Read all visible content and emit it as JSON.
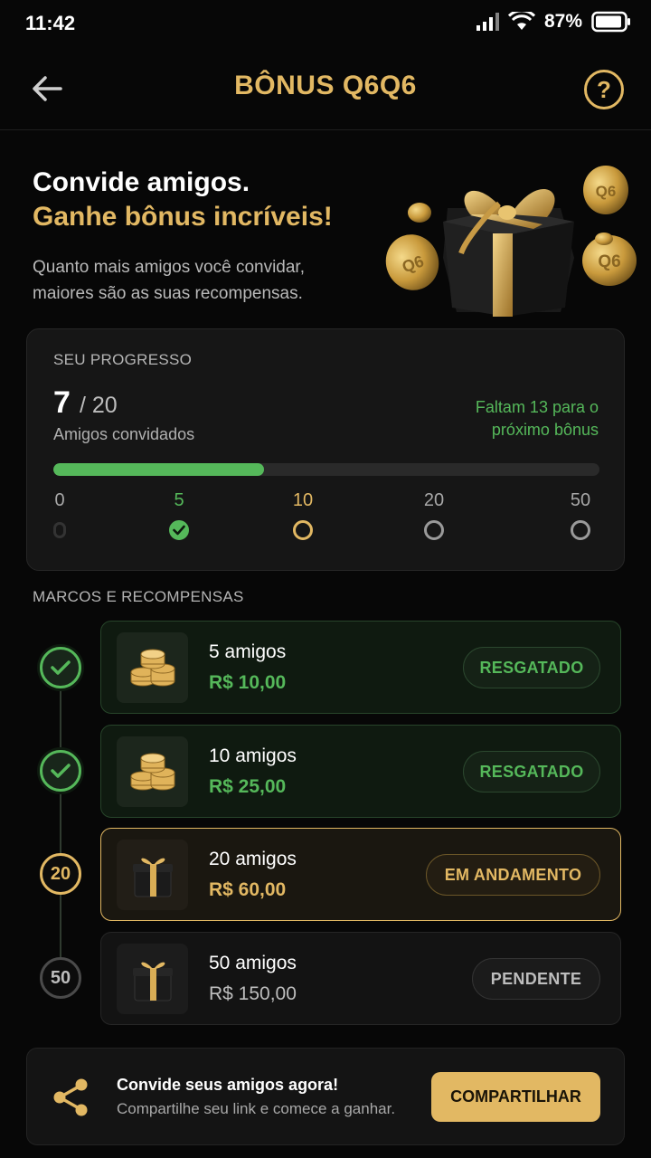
{
  "status_bar": {
    "time": "11:42",
    "battery": "87%"
  },
  "header": {
    "title": "BÔNUS Q6Q6",
    "help_icon_text": "?"
  },
  "hero": {
    "line1": "Convide amigos.",
    "line2": "Ganhe bônus incríveis!",
    "description": "Quanto mais amigos você convidar, maiores são as suas recompensas.",
    "coin_text": "Q6"
  },
  "progress": {
    "label": "SEU PROGRESSO",
    "current": "7",
    "total": "/ 20",
    "subtitle": "Amigos convidados",
    "remaining": "Faltam 13 para o próximo bônus",
    "fill_fraction": 0.386,
    "milestones": [
      "0",
      "5",
      "10",
      "20",
      "50"
    ]
  },
  "rewards": {
    "section_title": "MARCOS E RECOMPENSAS",
    "items": [
      {
        "node": "",
        "title": "5 amigos",
        "amount": "R$ 10,00",
        "status": "RESGATADO",
        "state": "done",
        "icon": "coins-icon"
      },
      {
        "node": "",
        "title": "10 amigos",
        "amount": "R$ 25,00",
        "status": "RESGATADO",
        "state": "done",
        "icon": "coins-icon"
      },
      {
        "node": "20",
        "title": "20 amigos",
        "amount": "R$ 60,00",
        "status": "EM ANDAMENTO",
        "state": "active",
        "icon": "gift-icon"
      },
      {
        "node": "50",
        "title": "50 amigos",
        "amount": "R$ 150,00",
        "status": "PENDENTE",
        "state": "pending",
        "icon": "gift-icon"
      }
    ]
  },
  "share": {
    "title": "Convide seus amigos agora!",
    "subtitle": "Compartilhe seu link e comece a ganhar.",
    "button": "COMPARTILHAR"
  },
  "colors": {
    "gold": "#e2b863",
    "green": "#55b85a",
    "background": "#070707"
  }
}
